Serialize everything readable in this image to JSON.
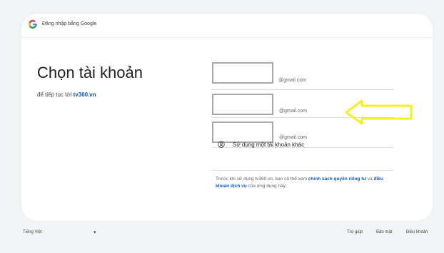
{
  "header": {
    "text": "Đăng nhập bằng Google"
  },
  "main": {
    "title": "Chọn tài khoản",
    "subtitle_prefix": "để tiếp tục tới",
    "site_name": "tv360.vn"
  },
  "accounts": [
    {
      "domain": "@gmail.com"
    },
    {
      "domain": "@gmail.com"
    },
    {
      "domain": "@gmail.com"
    }
  ],
  "other_account": {
    "label": "Sử dụng một tài khoản khác",
    "icon": "user-circle-icon"
  },
  "footnote": {
    "prefix": "Trước khi sử dụng tv360.vn, bạn có thể xem ",
    "privacy_link": "chính sách quyền riêng tư",
    "middle": " và ",
    "terms_link": "điều khoản dịch vụ",
    "suffix": " của ứng dụng này."
  },
  "footer": {
    "language": "Tiếng Việt",
    "links": [
      "Trợ giúp",
      "Bảo mật",
      "Điều khoản"
    ]
  },
  "annotation": {
    "color": "#f4f11b",
    "icon": "left-arrow-icon"
  },
  "colors": {
    "link": "#0b57d0",
    "background": "#f1f3f4"
  }
}
